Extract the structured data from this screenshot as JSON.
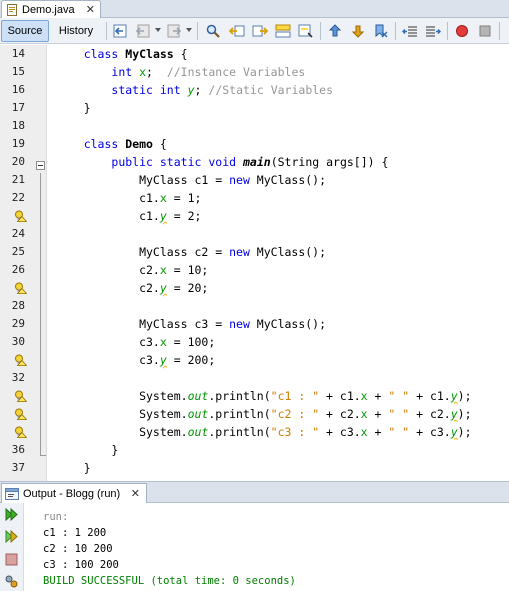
{
  "editor": {
    "file_tab": {
      "label": "Demo.java",
      "close": "✕"
    },
    "modes": {
      "source": "Source",
      "history": "History"
    }
  },
  "code": {
    "lines": [
      {
        "num": "14",
        "tokens": [
          [
            "",
            "    "
          ],
          [
            "kw",
            "class"
          ],
          [
            "",
            " "
          ],
          [
            "cls",
            "MyClass"
          ],
          [
            "",
            " {"
          ]
        ]
      },
      {
        "num": "15",
        "tokens": [
          [
            "",
            "        "
          ],
          [
            "kw",
            "int"
          ],
          [
            "",
            " "
          ],
          [
            "fld",
            "x"
          ],
          [
            "",
            ";  "
          ],
          [
            "cm",
            "//Instance Variables"
          ]
        ]
      },
      {
        "num": "16",
        "tokens": [
          [
            "",
            "        "
          ],
          [
            "kw",
            "static"
          ],
          [
            "",
            " "
          ],
          [
            "kw",
            "int"
          ],
          [
            "",
            " "
          ],
          [
            "sfld",
            "y"
          ],
          [
            "",
            "; "
          ],
          [
            "cm",
            "//Static Variables"
          ]
        ]
      },
      {
        "num": "17",
        "tokens": [
          [
            "",
            "    }"
          ]
        ]
      },
      {
        "num": "18",
        "tokens": []
      },
      {
        "num": "19",
        "tokens": [
          [
            "",
            "    "
          ],
          [
            "kw",
            "class"
          ],
          [
            "",
            " "
          ],
          [
            "cls",
            "Demo"
          ],
          [
            "",
            " {"
          ]
        ]
      },
      {
        "num": "20",
        "tokens": [
          [
            "",
            "        "
          ],
          [
            "kw",
            "public"
          ],
          [
            "",
            " "
          ],
          [
            "kw",
            "static"
          ],
          [
            "",
            " "
          ],
          [
            "kw",
            "void"
          ],
          [
            "",
            " "
          ],
          [
            "mth",
            "main"
          ],
          [
            "",
            "(String args[]) {"
          ]
        ]
      },
      {
        "num": "21",
        "tokens": [
          [
            "",
            "            MyClass c1 = "
          ],
          [
            "kw",
            "new"
          ],
          [
            "",
            " MyClass();"
          ]
        ]
      },
      {
        "num": "22",
        "tokens": [
          [
            "",
            "            c1."
          ],
          [
            "fld",
            "x"
          ],
          [
            "",
            " = 1;"
          ]
        ]
      },
      {
        "num": "",
        "hint": true,
        "tokens": [
          [
            "",
            "            c1."
          ],
          [
            "sfld uline",
            "y"
          ],
          [
            "",
            " = 2;"
          ]
        ]
      },
      {
        "num": "24",
        "tokens": []
      },
      {
        "num": "25",
        "tokens": [
          [
            "",
            "            MyClass c2 = "
          ],
          [
            "kw",
            "new"
          ],
          [
            "",
            " MyClass();"
          ]
        ]
      },
      {
        "num": "26",
        "tokens": [
          [
            "",
            "            c2."
          ],
          [
            "fld",
            "x"
          ],
          [
            "",
            " = 10;"
          ]
        ]
      },
      {
        "num": "",
        "hint": true,
        "tokens": [
          [
            "",
            "            c2."
          ],
          [
            "sfld uline",
            "y"
          ],
          [
            "",
            " = 20;"
          ]
        ]
      },
      {
        "num": "28",
        "tokens": []
      },
      {
        "num": "29",
        "tokens": [
          [
            "",
            "            MyClass c3 = "
          ],
          [
            "kw",
            "new"
          ],
          [
            "",
            " MyClass();"
          ]
        ]
      },
      {
        "num": "30",
        "tokens": [
          [
            "",
            "            c3."
          ],
          [
            "fld",
            "x"
          ],
          [
            "",
            " = 100;"
          ]
        ]
      },
      {
        "num": "",
        "hint": true,
        "tokens": [
          [
            "",
            "            c3."
          ],
          [
            "sfld uline",
            "y"
          ],
          [
            "",
            " = 200;"
          ]
        ]
      },
      {
        "num": "32",
        "tokens": []
      },
      {
        "num": "",
        "hint": true,
        "tokens": [
          [
            "",
            "            System."
          ],
          [
            "sfld",
            "out"
          ],
          [
            "",
            ".println("
          ],
          [
            "str",
            "\"c1 : \""
          ],
          [
            "",
            " + c1."
          ],
          [
            "fld",
            "x"
          ],
          [
            "",
            " + "
          ],
          [
            "str",
            "\" \""
          ],
          [
            "",
            " + c1."
          ],
          [
            "sfld uline",
            "y"
          ],
          [
            "",
            ");"
          ]
        ]
      },
      {
        "num": "",
        "hint": true,
        "tokens": [
          [
            "",
            "            System."
          ],
          [
            "sfld",
            "out"
          ],
          [
            "",
            ".println("
          ],
          [
            "str",
            "\"c2 : \""
          ],
          [
            "",
            " + c2."
          ],
          [
            "fld",
            "x"
          ],
          [
            "",
            " + "
          ],
          [
            "str",
            "\" \""
          ],
          [
            "",
            " + c2."
          ],
          [
            "sfld uline",
            "y"
          ],
          [
            "",
            ");"
          ]
        ]
      },
      {
        "num": "",
        "hint": true,
        "tokens": [
          [
            "",
            "            System."
          ],
          [
            "sfld",
            "out"
          ],
          [
            "",
            ".println("
          ],
          [
            "str",
            "\"c3 : \""
          ],
          [
            "",
            " + c3."
          ],
          [
            "fld",
            "x"
          ],
          [
            "",
            " + "
          ],
          [
            "str",
            "\" \""
          ],
          [
            "",
            " + c3."
          ],
          [
            "sfld uline",
            "y"
          ],
          [
            "",
            ");"
          ]
        ]
      },
      {
        "num": "36",
        "tokens": [
          [
            "",
            "        }"
          ]
        ]
      },
      {
        "num": "37",
        "tokens": [
          [
            "",
            "    }"
          ]
        ]
      }
    ]
  },
  "output": {
    "tab_label": "Output - Blogg (run)",
    "close": "✕",
    "lines": [
      {
        "text": "run:",
        "style": "muted"
      },
      {
        "text": "c1 : 1 200",
        "style": ""
      },
      {
        "text": "c2 : 10 200",
        "style": ""
      },
      {
        "text": "c3 : 100 200",
        "style": ""
      },
      {
        "text": "BUILD SUCCESSFUL (total time: 0 seconds)",
        "style": "success"
      }
    ]
  },
  "icons": {
    "toolbar": [
      "last-edit-icon",
      "back-icon",
      "forward-icon",
      "find-icon",
      "find-previous-icon",
      "find-next-icon",
      "find-selection-icon",
      "toggle-highlight-icon",
      "previous-bookmark-icon",
      "next-bookmark-icon",
      "toggle-bookmark-icon",
      "shift-left-icon",
      "shift-right-icon",
      "start-macro-icon",
      "stop-macro-icon"
    ],
    "gutter_hint": "hint-bulb-icon",
    "output_side": [
      "rerun-icon",
      "rerun-with-params-icon",
      "stop-icon",
      "settings-icon"
    ]
  }
}
